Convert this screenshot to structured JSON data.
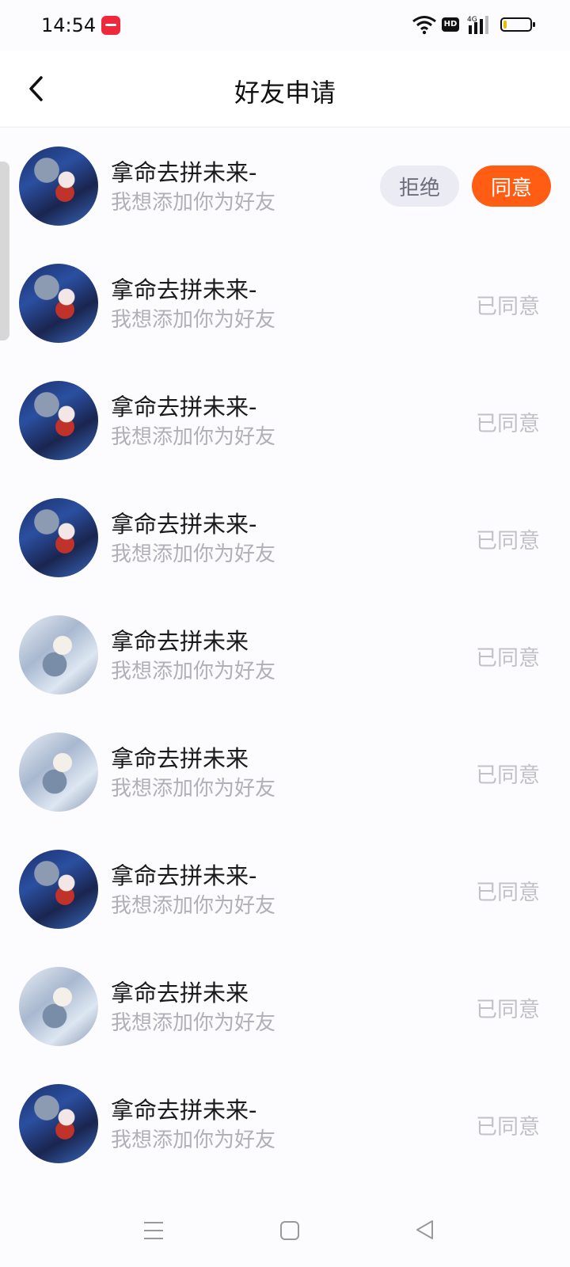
{
  "status_bar": {
    "time": "14:54",
    "hd_label": "HD",
    "network_label": "4G"
  },
  "header": {
    "title": "好友申请"
  },
  "requests": [
    {
      "name": "拿命去拼未来-",
      "message": "我想添加你为好友",
      "avatar": "avatar-red-armor",
      "state": "pending"
    },
    {
      "name": "拿命去拼未来-",
      "message": "我想添加你为好友",
      "avatar": "avatar-red-armor",
      "state": "已同意"
    },
    {
      "name": "拿命去拼未来-",
      "message": "我想添加你为好友",
      "avatar": "avatar-red-armor",
      "state": "已同意"
    },
    {
      "name": "拿命去拼未来-",
      "message": "我想添加你为好友",
      "avatar": "avatar-red-armor",
      "state": "已同意"
    },
    {
      "name": "拿命去拼未来",
      "message": "我想添加你为好友",
      "avatar": "avatar-white-hair",
      "state": "已同意"
    },
    {
      "name": "拿命去拼未来",
      "message": "我想添加你为好友",
      "avatar": "avatar-white-hair",
      "state": "已同意"
    },
    {
      "name": "拿命去拼未来-",
      "message": "我想添加你为好友",
      "avatar": "avatar-red-armor",
      "state": "已同意"
    },
    {
      "name": "拿命去拼未来",
      "message": "我想添加你为好友",
      "avatar": "avatar-white-hair",
      "state": "已同意"
    },
    {
      "name": "拿命去拼未来-",
      "message": "我想添加你为好友",
      "avatar": "avatar-red-armor",
      "state": "已同意"
    }
  ],
  "actions": {
    "reject_label": "拒绝",
    "accept_label": "同意"
  },
  "colors": {
    "accent": "#ff5c14",
    "reject_bg": "#ebebf4",
    "muted_text": "#b0b0b6"
  },
  "icons": {
    "back": "chevron-left-icon",
    "wifi": "wifi-icon",
    "signal": "signal-icon",
    "battery": "battery-icon",
    "nav_menu": "menu-icon",
    "nav_home": "home-square-icon",
    "nav_back": "back-triangle-icon"
  }
}
